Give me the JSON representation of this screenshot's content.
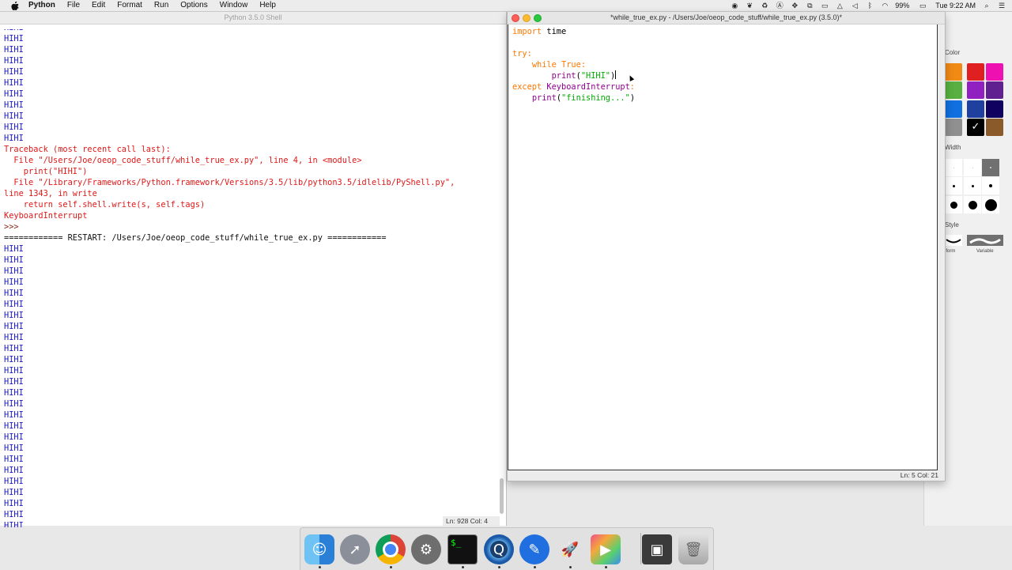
{
  "menubar": {
    "app_name": "Python",
    "items": [
      "File",
      "Edit",
      "Format",
      "Run",
      "Options",
      "Window",
      "Help"
    ],
    "battery": "99%",
    "clock": "Tue 9:22 AM"
  },
  "shell": {
    "title": "Python 3.5.0 Shell",
    "output_text": "HIHI",
    "traceback": [
      "Traceback (most recent call last):",
      "  File \"/Users/Joe/oeop_code_stuff/while_true_ex.py\", line 4, in <module>",
      "    print(\"HIHI\")",
      "  File \"/Library/Frameworks/Python.framework/Versions/3.5/lib/python3.5/idlelib/PyShell.py\",",
      "line 1343, in write",
      "    return self.shell.write(s, self.tags)",
      "KeyboardInterrupt"
    ],
    "prompt": ">>>",
    "restart_line": "============ RESTART: /Users/Joe/oeop_code_stuff/while_true_ex.py ============",
    "status": "Ln: 928 Col: 4"
  },
  "editor": {
    "title": "*while_true_ex.py - /Users/Joe/oeop_code_stuff/while_true_ex.py (3.5.0)*",
    "code": {
      "l1_kw": "import",
      "l1_rest": " time",
      "l3_kw": "try",
      "l3_rest": ":",
      "l4_indent": "    ",
      "l4_kw": "while",
      "l4_sp": " ",
      "l4_bi": "True",
      "l4_rest": ":",
      "l5_indent": "        ",
      "l5_fn": "print",
      "l5_open": "(",
      "l5_str": "\"HIHI\"",
      "l5_close": ")",
      "l6_kw": "except",
      "l6_sp": " ",
      "l6_bi": "KeyboardInterrupt",
      "l6_rest": ":",
      "l7_indent": "    ",
      "l7_fn": "print",
      "l7_open": "(",
      "l7_str": "\"finishing...\"",
      "l7_close": ")"
    },
    "status": "Ln: 5 Col: 21"
  },
  "color_panel": {
    "color_label": "Color",
    "width_label": "Width",
    "style_label": "Style",
    "style_uniform": "iform",
    "style_variable": "Variable",
    "swatches": [
      "#f08a14",
      "#e02020",
      "#ee10b0",
      "#58b040",
      "#9020c0",
      "#602090",
      "#1070e0",
      "#2040a0",
      "#100060",
      "#909090",
      "#000000",
      "#8b5a2b"
    ],
    "selected_check": "✓"
  },
  "dock": {
    "apps": [
      "Finder",
      "Launchpad",
      "Chrome",
      "System Preferences",
      "Terminal",
      "QuickTime Player",
      "Pencil",
      "Rocket",
      "Final Cut Pro",
      "Folder",
      "Trash"
    ],
    "terminal_glyph": "$_"
  }
}
